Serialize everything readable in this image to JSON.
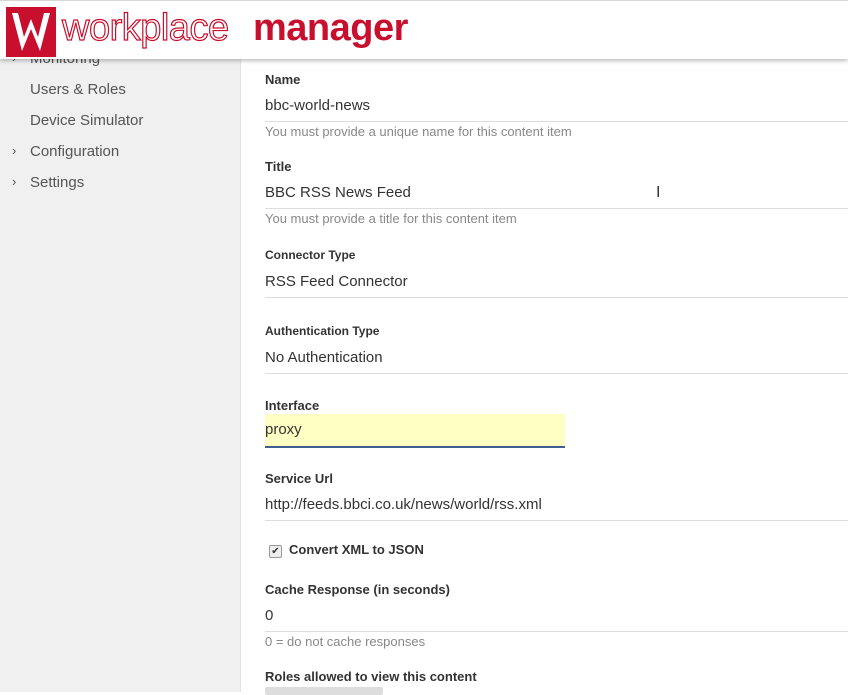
{
  "brand": {
    "light": "workplace",
    "bold": "manager"
  },
  "sidebar": {
    "items": [
      {
        "label": "Monitoring",
        "chevron": true
      },
      {
        "label": "Users & Roles",
        "chevron": false
      },
      {
        "label": "Device Simulator",
        "chevron": false
      },
      {
        "label": "Configuration",
        "chevron": true
      },
      {
        "label": "Settings",
        "chevron": true
      }
    ]
  },
  "form": {
    "name": {
      "label": "Name",
      "value": "bbc-world-news",
      "hint": "You must provide a unique name for this content item"
    },
    "title": {
      "label": "Title",
      "value": "BBC RSS News Feed",
      "hint": "You must provide a title for this content item"
    },
    "connector_type": {
      "label": "Connector Type",
      "value": "RSS Feed Connector"
    },
    "auth_type": {
      "label": "Authentication Type",
      "value": "No Authentication"
    },
    "interface": {
      "label": "Interface",
      "value": "proxy"
    },
    "service_url": {
      "label": "Service Url",
      "value": "http://feeds.bbci.co.uk/news/world/rss.xml"
    },
    "convert_xml": {
      "label": "Convert XML to JSON",
      "checked": true
    },
    "cache": {
      "label": "Cache Response (in seconds)",
      "value": "0",
      "hint": "0 = do not cache responses"
    },
    "roles": {
      "label": "Roles allowed to view this content"
    }
  },
  "colors": {
    "brand": "#c8102e",
    "interface_bg": "#ffffc4",
    "interface_border": "#3f5f8f"
  }
}
